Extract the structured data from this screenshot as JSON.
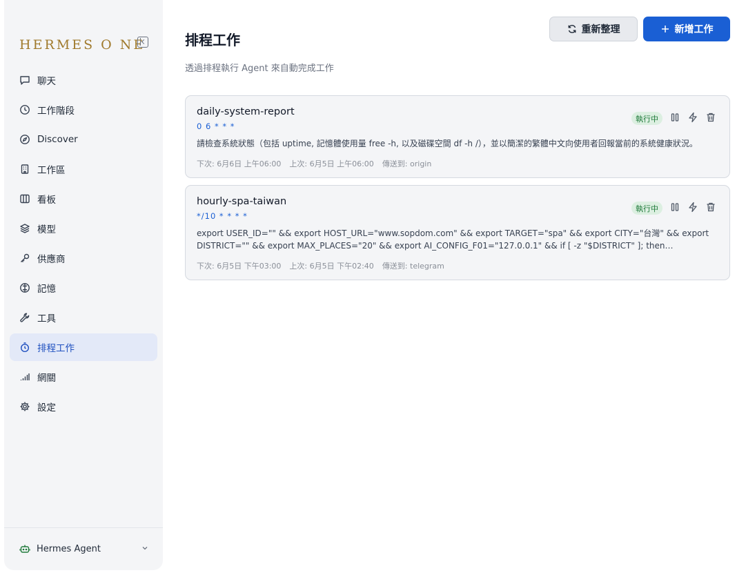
{
  "sidebar": {
    "brand": "HERMES O NE",
    "items": [
      {
        "label": "聊天",
        "icon": "chat-icon"
      },
      {
        "label": "工作階段",
        "icon": "clock-icon"
      },
      {
        "label": "Discover",
        "icon": "compass-icon"
      },
      {
        "label": "工作區",
        "icon": "building-icon"
      },
      {
        "label": "看板",
        "icon": "board-icon"
      },
      {
        "label": "模型",
        "icon": "layers-icon"
      },
      {
        "label": "供應商",
        "icon": "key-icon"
      },
      {
        "label": "記憶",
        "icon": "brain-icon"
      },
      {
        "label": "工具",
        "icon": "wrench-icon"
      },
      {
        "label": "排程工作",
        "icon": "timer-icon",
        "active": true
      },
      {
        "label": "網關",
        "icon": "signal-icon"
      },
      {
        "label": "設定",
        "icon": "gear-icon"
      }
    ],
    "agent": {
      "label": "Hermes Agent",
      "icon": "robot-icon"
    }
  },
  "header": {
    "title": "排程工作",
    "subtitle": "透過排程執行 Agent 來自動完成工作",
    "refresh_label": "重新整理",
    "add_label": "新增工作"
  },
  "jobs": [
    {
      "name": "daily-system-report",
      "cron": "0 6 * * *",
      "description": "請檢查系統狀態（包括 uptime, 記憶體使用量 free -h, 以及磁碟空間 df -h /），並以簡潔的繁體中文向使用者回報當前的系統健康狀況。",
      "next": "下次: 6月6日 上午06:00",
      "last": "上次: 6月5日 上午06:00",
      "deliver": "傳送到: origin",
      "status": "執行中"
    },
    {
      "name": "hourly-spa-taiwan",
      "cron": "*/10 * * * *",
      "description": "export USER_ID=\"\" && export HOST_URL=\"www.sopdom.com\" && export TARGET=\"spa\" && export CITY=\"台灣\" && export DISTRICT=\"\" && export MAX_PLACES=\"20\" && export AI_CONFIG_F01=\"127.0.0.1\" && if [ -z \"$DISTRICT\" ]; then KEYWORDS=\"${CITY} ${TARGET}\"; else KEYWORDS=\"${CITY} ${DISTRICT} ${TARGET}\"; fi",
      "next": "下次: 6月5日 下午03:00",
      "last": "上次: 6月5日 下午02:40",
      "deliver": "傳送到: telegram",
      "status": "執行中"
    }
  ],
  "colors": {
    "accent": "#1a5fd4",
    "brand": "#a07a2c",
    "status_bg": "#dcefe1",
    "status_text": "#1f7a3a",
    "active_nav_bg": "#e3e9f8"
  }
}
